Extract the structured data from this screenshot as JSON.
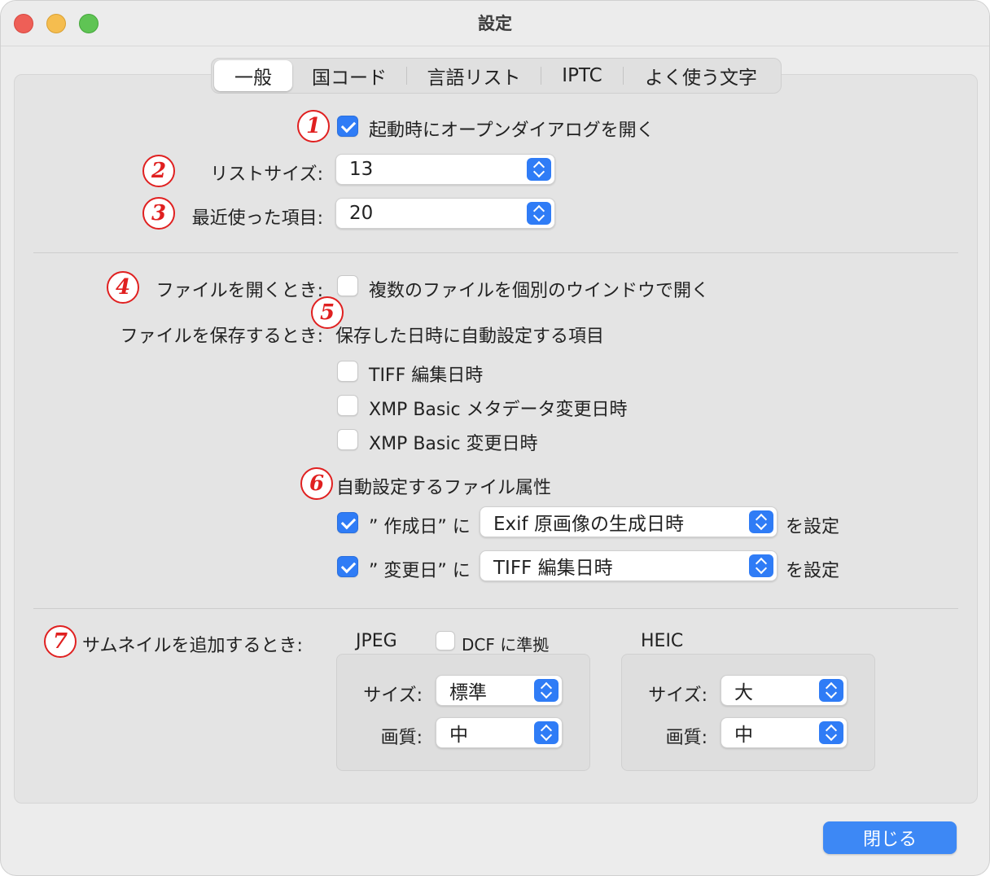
{
  "window": {
    "title": "設定"
  },
  "tabs": [
    {
      "label": "一般",
      "active": true
    },
    {
      "label": "国コード",
      "active": false
    },
    {
      "label": "言語リスト",
      "active": false
    },
    {
      "label": "IPTC",
      "active": false
    },
    {
      "label": "よく使う文字",
      "active": false
    }
  ],
  "markers": [
    "1",
    "2",
    "3",
    "4",
    "5",
    "6",
    "7"
  ],
  "general": {
    "open_dialog_label": "起動時にオープンダイアログを開く",
    "open_dialog_checked": true,
    "list_size_label": "リストサイズ:",
    "list_size_value": "13",
    "recent_items_label": "最近使った項目:",
    "recent_items_value": "20"
  },
  "file_open": {
    "label": "ファイルを開くとき:",
    "option_label": "複数のファイルを個別のウインドウで開く",
    "option_checked": false
  },
  "file_save": {
    "label": "ファイルを保存するとき:",
    "heading": "保存した日時に自動設定する項目",
    "options": [
      {
        "label": "TIFF 編集日時",
        "checked": false
      },
      {
        "label": "XMP Basic メタデータ変更日時",
        "checked": false
      },
      {
        "label": "XMP Basic 変更日時",
        "checked": false
      }
    ]
  },
  "file_attributes": {
    "heading": "自動設定するファイル属性",
    "rows": [
      {
        "checked": true,
        "label": "” 作成日” に",
        "value": "Exif 原画像の生成日時",
        "suffix": "を設定"
      },
      {
        "checked": true,
        "label": "” 変更日” に",
        "value": "TIFF 編集日時",
        "suffix": "を設定"
      }
    ]
  },
  "thumbnail": {
    "label": "サムネイルを追加するとき:",
    "jpeg": {
      "title": "JPEG",
      "dcf_label": "DCF に準拠",
      "dcf_checked": false,
      "size_label": "サイズ:",
      "size_value": "標準",
      "quality_label": "画質:",
      "quality_value": "中"
    },
    "heic": {
      "title": "HEIC",
      "size_label": "サイズ:",
      "size_value": "大",
      "quality_label": "画質:",
      "quality_value": "中"
    }
  },
  "footer": {
    "close_label": "閉じる"
  },
  "colors": {
    "accent": "#2f7cf6",
    "marker": "#e02020"
  }
}
